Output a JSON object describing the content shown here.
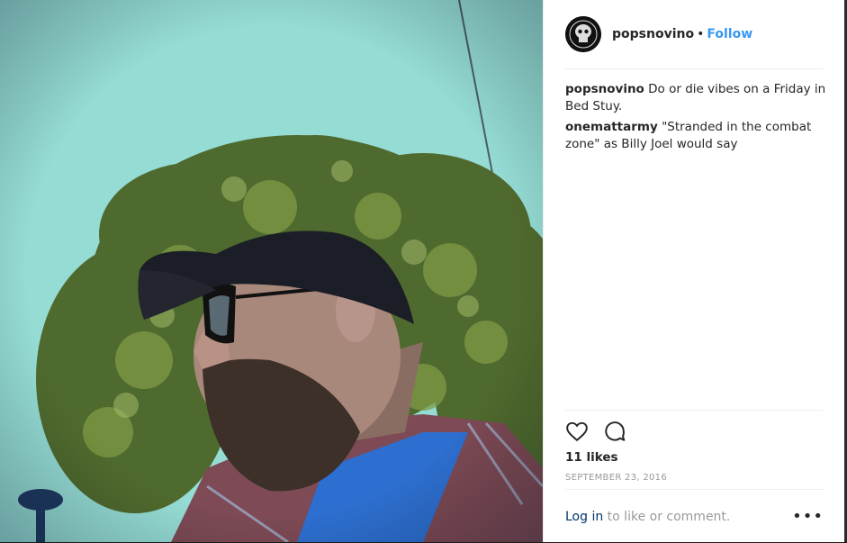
{
  "post": {
    "username": "popsnovino",
    "separator": "•",
    "follow_label": "Follow"
  },
  "comments": [
    {
      "user": "popsnovino",
      "text": "Do or die vibes on a Friday in Bed Stuy."
    },
    {
      "user": "onemattarmy",
      "text": "\"Stranded in the combat zone\" as Billy Joel would say"
    }
  ],
  "actions": {
    "like_icon": "heart-icon",
    "comment_icon": "comment-icon",
    "likes_text": "11 likes",
    "date_text": "SEPTEMBER 23, 2016"
  },
  "footer": {
    "login_link": "Log in",
    "login_rest": "to like or comment.",
    "more_label": "•••"
  },
  "colors": {
    "link_blue": "#3897f0",
    "login_blue": "#003569",
    "text": "#262626",
    "muted": "#999999"
  }
}
